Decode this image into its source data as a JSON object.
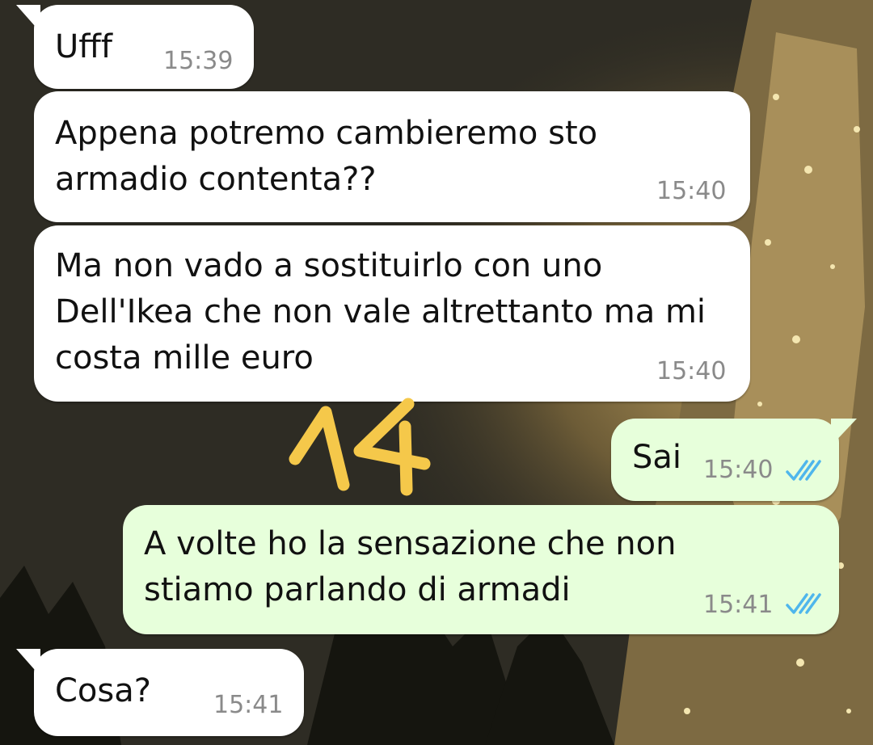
{
  "messages": [
    {
      "direction": "incoming",
      "text": "Ufff",
      "time": "15:39"
    },
    {
      "direction": "incoming",
      "text": "Appena potremo cambieremo sto\narmadio contenta??",
      "time": "15:40"
    },
    {
      "direction": "incoming",
      "text": "Ma non vado a sostituirlo con uno\nDell'Ikea che non vale altrettanto ma mi\ncosta mille euro",
      "time": "15:40"
    },
    {
      "direction": "outgoing",
      "text": "Sai",
      "time": "15:40",
      "status": "read"
    },
    {
      "direction": "outgoing",
      "text": "A volte ho la sensazione che non\nstiamo parlando di armadi",
      "time": "15:41",
      "status": "read"
    },
    {
      "direction": "incoming",
      "text": "Cosa?",
      "time": "15:41"
    }
  ],
  "overlay_annotation": {
    "text": "14",
    "color": "#f5c84a"
  },
  "colors": {
    "incoming_bubble": "#ffffff",
    "outgoing_bubble": "#e7ffdb",
    "read_ticks": "#4fb6ec",
    "timestamp": "#8a8a8a"
  },
  "icons": {
    "read_receipt": "double-check-icon"
  }
}
